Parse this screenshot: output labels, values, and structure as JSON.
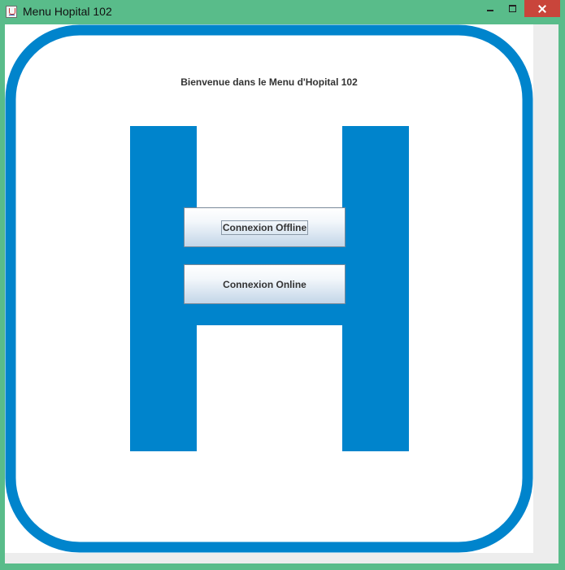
{
  "window": {
    "title": "Menu Hopital 102",
    "icon": "java-cup-icon",
    "controls": [
      "minimize",
      "maximize",
      "close"
    ],
    "titlebar_color": "#59bc8a",
    "close_color": "#c9453b"
  },
  "main": {
    "welcome_text": "Bienvenue dans le Menu d'Hopital 102",
    "logo": "hospital-h-sign",
    "logo_color": "#0084cc",
    "buttons": {
      "offline_label": "Connexion Offline",
      "online_label": "Connexion Online",
      "focused": "offline"
    }
  }
}
